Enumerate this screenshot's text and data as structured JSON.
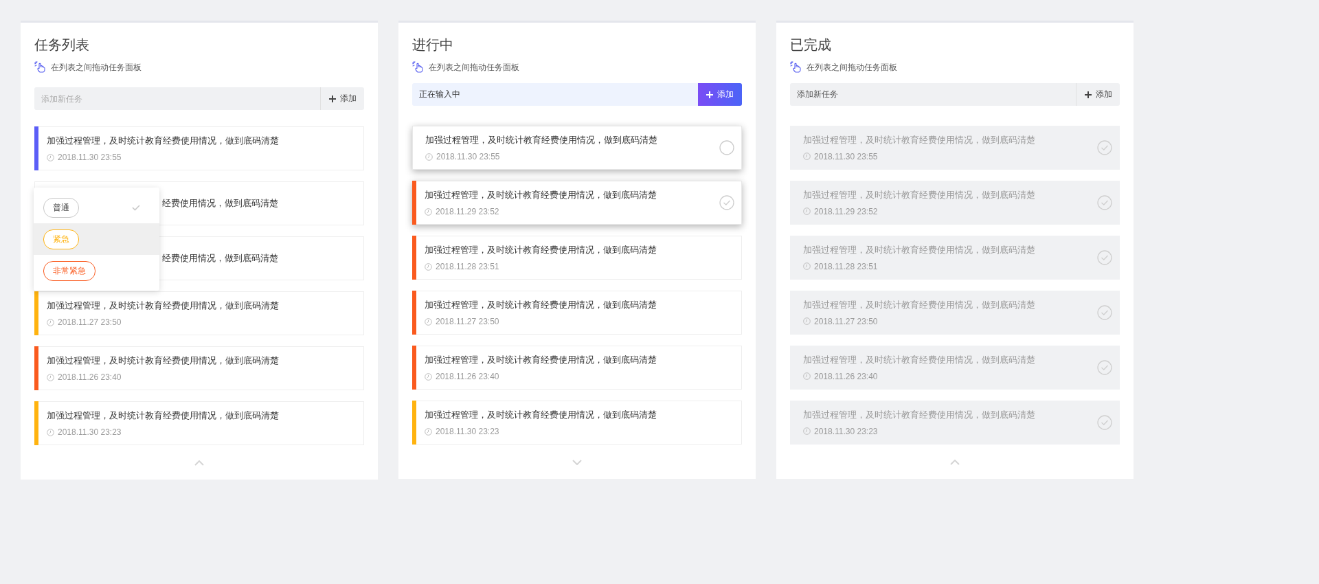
{
  "columns": [
    {
      "title": "任务列表",
      "hint": "在列表之间拖动任务面板",
      "input": {
        "placeholder": "添加新任务",
        "focused": false
      },
      "add_button": "添加",
      "done": false,
      "footer_expanded": true,
      "cards": [
        {
          "text": "加强过程管理，及时统计教育经费使用情况，做到底码清楚",
          "date": "2018.11.30 23:55",
          "color": "#5b5ef7",
          "raised": false
        },
        {
          "text": "经费使用情况，做到底码清楚",
          "raised": false,
          "covered": true
        },
        {
          "text": "经费使用情况，做到底码清楚",
          "raised": false,
          "covered": true
        },
        {
          "text": "加强过程管理，及时统计教育经费使用情况，做到底码清楚",
          "date": "2018.11.27 23:50",
          "color": "#ffb30f",
          "raised": false
        },
        {
          "text": "加强过程管理，及时统计教育经费使用情况，做到底码清楚",
          "date": "2018.11.26 23:40",
          "color": "#fa5a1e",
          "raised": false
        },
        {
          "text": "加强过程管理，及时统计教育经费使用情况，做到底码清楚",
          "date": "2018.11.30 23:23",
          "color": "#ffb30f",
          "raised": false
        }
      ],
      "menu": [
        {
          "label": "普通",
          "color": "#c8c8c8",
          "selected": true,
          "highlighted": false
        },
        {
          "label": "紧急",
          "color": "#ffb30f",
          "selected": false,
          "highlighted": true
        },
        {
          "label": "非常紧急",
          "color": "#fa5a1e",
          "selected": false,
          "highlighted": false
        }
      ]
    },
    {
      "title": "进行中",
      "hint": "在列表之间拖动任务面板",
      "input": {
        "value": "正在输入中",
        "focused": true
      },
      "add_button": "添加",
      "done": false,
      "footer_expanded": false,
      "cards": [
        {
          "text": "加强过程管理，及时统计教育经费使用情况，做到底码清楚",
          "date": "2018.11.30 23:55",
          "raised": true,
          "checked": false
        },
        {
          "text": "加强过程管理，及时统计教育经费使用情况，做到底码清楚",
          "date": "2018.11.29 23:52",
          "color": "#fa5a1e",
          "raised": true,
          "checked": true
        },
        {
          "text": "加强过程管理，及时统计教育经费使用情况，做到底码清楚",
          "date": "2018.11.28 23:51",
          "color": "#fa5a1e",
          "raised": false
        },
        {
          "text": "加强过程管理，及时统计教育经费使用情况，做到底码清楚",
          "date": "2018.11.27 23:50",
          "color": "#fa5a1e",
          "raised": false
        },
        {
          "text": "加强过程管理，及时统计教育经费使用情况，做到底码清楚",
          "date": "2018.11.26 23:40",
          "color": "#fa5a1e",
          "raised": false
        },
        {
          "text": "加强过程管理，及时统计教育经费使用情况，做到底码清楚",
          "date": "2018.11.30 23:23",
          "color": "#ffb30f",
          "raised": false
        }
      ]
    },
    {
      "title": "已完成",
      "hint": "在列表之间拖动任务面板",
      "input": {
        "value": "添加新任务",
        "focused": false
      },
      "add_button": "添加",
      "done": true,
      "footer_expanded": true,
      "cards": [
        {
          "text": "加强过程管理，及时统计教育经费使用情况，做到底码清楚",
          "date": "2018.11.30 23:55",
          "raised": false,
          "checked": true
        },
        {
          "text": "加强过程管理，及时统计教育经费使用情况，做到底码清楚",
          "date": "2018.11.29 23:52",
          "raised": false,
          "checked": true
        },
        {
          "text": "加强过程管理，及时统计教育经费使用情况，做到底码清楚",
          "date": "2018.11.28 23:51",
          "raised": false,
          "checked": true
        },
        {
          "text": "加强过程管理，及时统计教育经费使用情况，做到底码清楚",
          "date": "2018.11.27 23:50",
          "raised": false,
          "checked": true
        },
        {
          "text": "加强过程管理，及时统计教育经费使用情况，做到底码清楚",
          "date": "2018.11.26 23:40",
          "raised": false,
          "checked": true
        },
        {
          "text": "加强过程管理，及时统计教育经费使用情况，做到底码清楚",
          "date": "2018.11.30 23:23",
          "raised": false,
          "checked": true
        }
      ]
    }
  ]
}
